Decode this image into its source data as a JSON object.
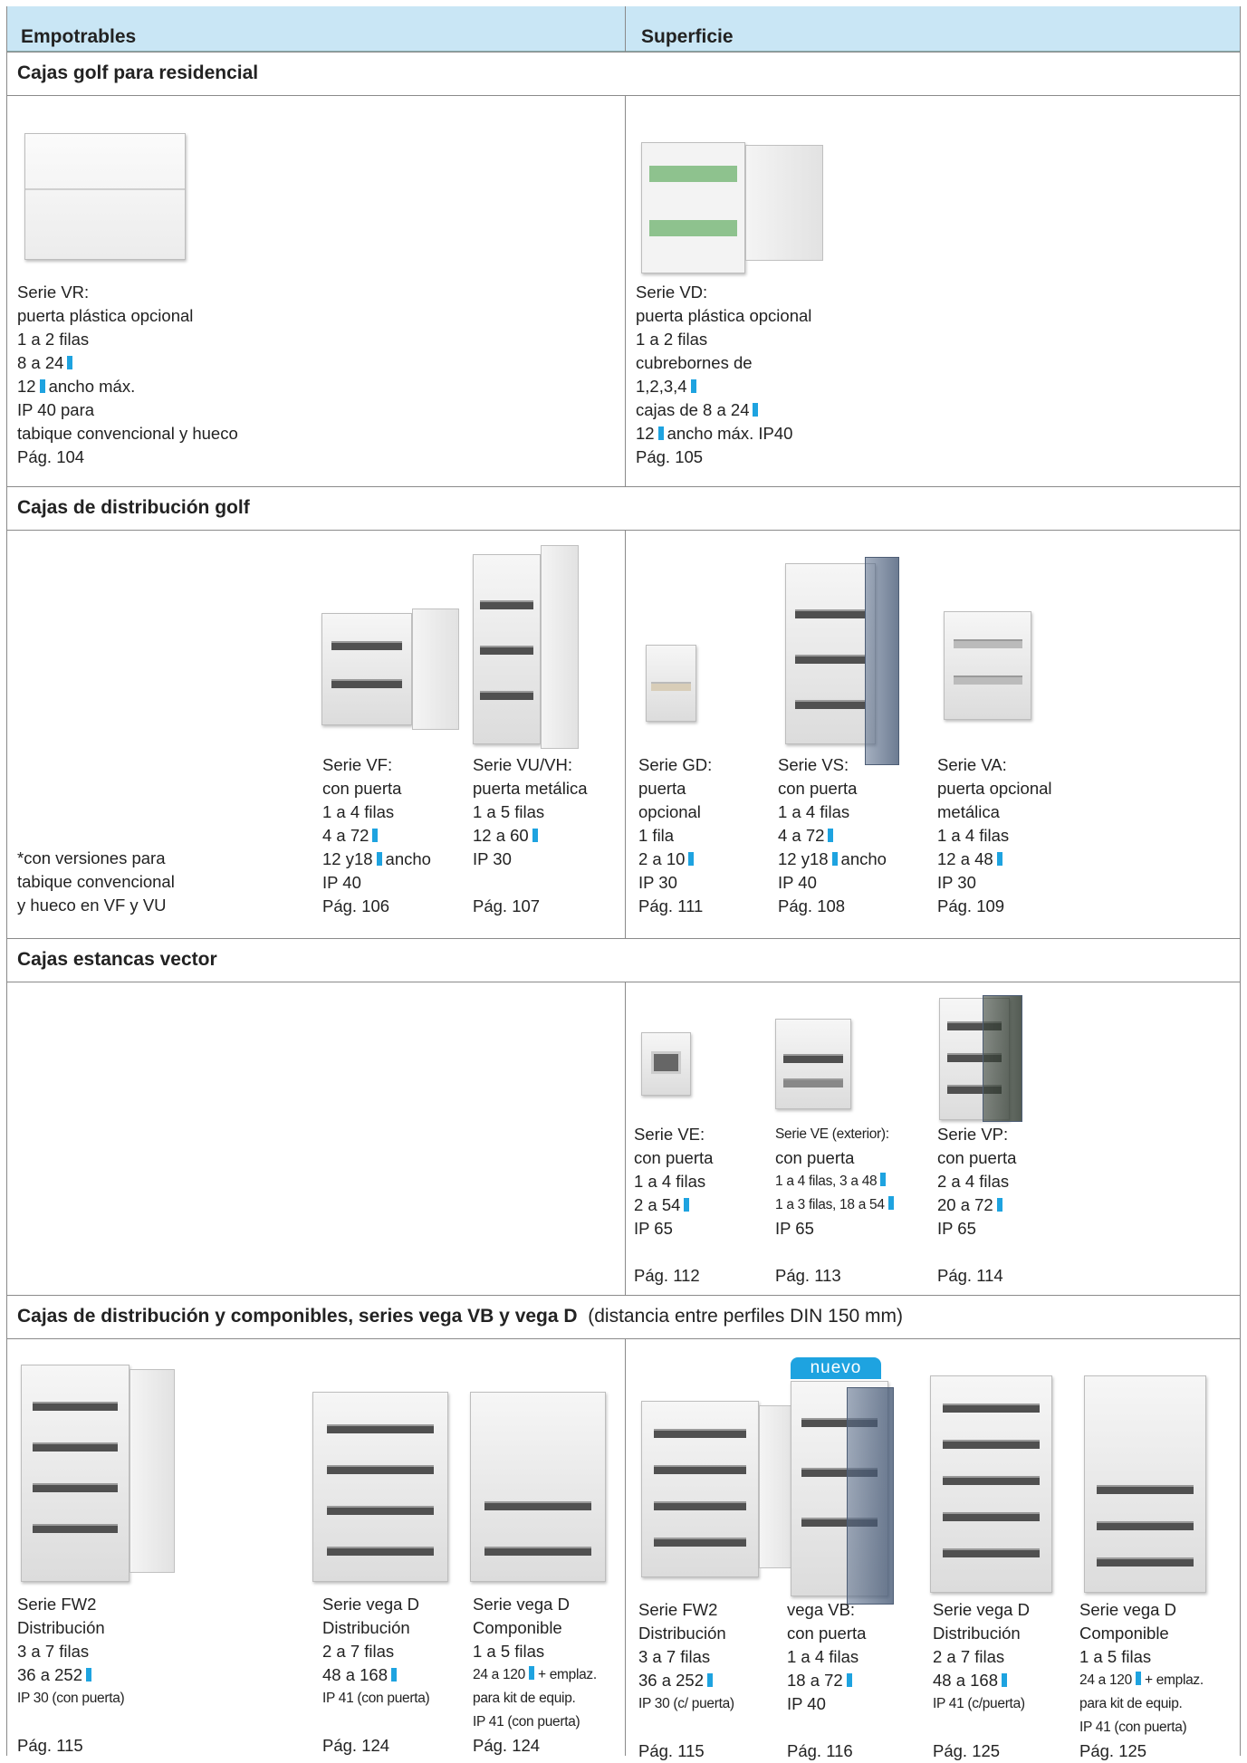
{
  "header": {
    "left": "Empotrables",
    "right": "Superficie"
  },
  "sections": {
    "s1": {
      "title": "Cajas golf para residencial"
    },
    "s2": {
      "title": "Cajas de distribución golf"
    },
    "s3": {
      "title": "Cajas estancas vector"
    },
    "s4": {
      "title": "Cajas de distribución y componibles, series vega VB y vega D",
      "note": "(distancia entre perfiles DIN 150 mm)"
    }
  },
  "vr": [
    "Serie VR:",
    "puerta plástica opcional",
    "1 a 2 filas",
    "8 a 24",
    "12",
    "ancho máx.",
    "IP 40 para",
    "tabique convencional y hueco",
    "Pág. 104"
  ],
  "vd": [
    "Serie VD:",
    "puerta plástica opcional",
    "1 a 2 filas",
    "cubrebornes de",
    "1,2,3,4",
    "cajas de 8 a 24",
    "12",
    "ancho máx. IP40",
    "Pág. 105"
  ],
  "note": [
    "*con versiones para",
    "tabique convencional",
    "y hueco en VF y VU"
  ],
  "vf": [
    "Serie VF:",
    "con puerta",
    "1 a 4 filas",
    "4 a 72",
    "12 y18",
    "ancho",
    "IP 40",
    "Pág. 106"
  ],
  "vu": [
    "Serie VU/VH:",
    "puerta metálica",
    "1 a 5 filas",
    "12 a 60",
    "IP 30",
    "Pág. 107"
  ],
  "gd": [
    "Serie GD:",
    "puerta",
    "opcional",
    "1  fila",
    "2 a 10",
    "IP 30",
    "Pág. 111"
  ],
  "vs": [
    "Serie VS:",
    "con puerta",
    "1 a 4 filas",
    "4 a 72",
    "12 y18",
    "ancho",
    "IP 40",
    "Pág. 108"
  ],
  "va": [
    "Serie VA:",
    "puerta opcional",
    "metálica",
    "1 a 4 filas",
    "12 a 48",
    "IP 30",
    "Pág. 109"
  ],
  "ve": [
    "Serie VE:",
    "con puerta",
    "1 a 4 filas",
    "2 a 54",
    "IP 65",
    "Pág. 112"
  ],
  "vex": [
    "Serie VE (exterior):",
    "con puerta",
    "1 a 4 filas, 3 a 48",
    "1 a 3 filas, 18 a 54",
    "IP 65",
    "Pág. 113"
  ],
  "vp": [
    "Serie VP:",
    "con puerta",
    "2 a 4 filas",
    "20 a 72",
    "IP 65",
    "Pág. 114"
  ],
  "fw2a": [
    "Serie FW2",
    "Distribución",
    "3 a 7 filas",
    "36 a 252",
    "IP 30 (con puerta)",
    "Pág. 115"
  ],
  "vegadA": [
    "Serie vega D",
    "Distribución",
    "2 a 7 filas",
    "48 a 168",
    "IP 41 (con puerta)",
    "Pág. 124"
  ],
  "vegacA": [
    "Serie vega D",
    "Componible",
    "1 a 5 filas",
    "24 a 120",
    "+ emplaz.",
    "para  kit  de equip.",
    "IP 41 (con puerta)",
    "Pág. 124"
  ],
  "fw2b": [
    "Serie FW2",
    "Distribución",
    "3 a 7 filas",
    "36 a 252",
    "IP 30  (c/ puerta)",
    "Pág. 115"
  ],
  "vb": {
    "badge": "nuevo",
    "lines": [
      "vega VB:",
      "con puerta",
      "1 a 4 filas",
      "18 a 72",
      "IP 40",
      "Pág. 116"
    ]
  },
  "vegadB": [
    "Serie vega D",
    "Distribución",
    "2 a 7 filas",
    "48 a 168",
    "IP 41 (c/puerta)",
    "Pág. 125"
  ],
  "vegacB": [
    "Serie vega D",
    "Componible",
    "1 a 5 filas",
    "24 a 120",
    "+ emplaz.",
    "para kit de equip.",
    "IP 41 (con puerta)",
    "Pág. 125"
  ],
  "colors": {
    "header_bg": "#c9e6f5",
    "module_icon": "#1ea3e0",
    "badge": "#1ea3e0"
  }
}
